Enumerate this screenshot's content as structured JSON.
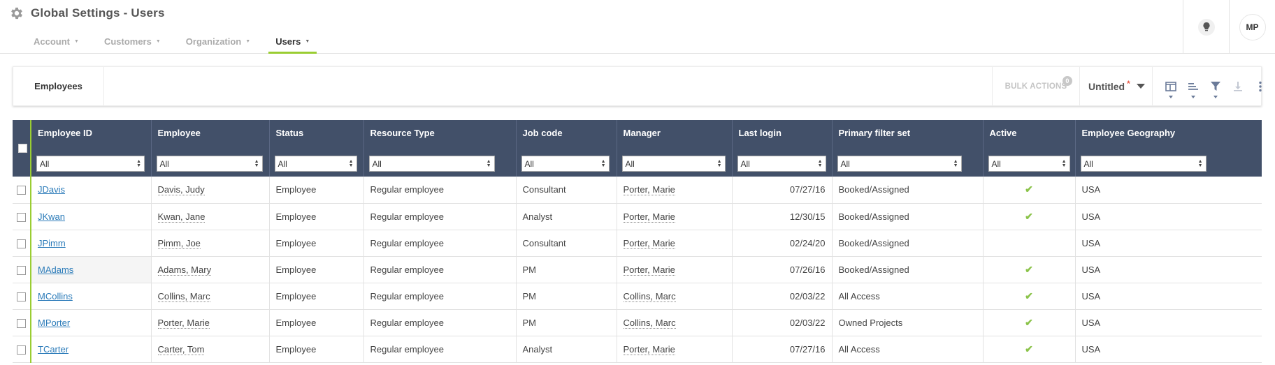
{
  "header": {
    "title": "Global Settings - Users",
    "tabs": [
      {
        "label": "Account"
      },
      {
        "label": "Customers"
      },
      {
        "label": "Organization"
      },
      {
        "label": "Users"
      }
    ],
    "avatar_initials": "MP"
  },
  "toolbar": {
    "view_title": "Employees",
    "bulk_actions_label": "BULK ACTIONS",
    "bulk_actions_count": "0",
    "saved_view_name": "Untitled",
    "unsaved_marker": "*"
  },
  "table": {
    "columns": [
      {
        "label": "Employee ID",
        "filter": "All"
      },
      {
        "label": "Employee",
        "filter": "All"
      },
      {
        "label": "Status",
        "filter": "All"
      },
      {
        "label": "Resource Type",
        "filter": "All"
      },
      {
        "label": "Job code",
        "filter": "All"
      },
      {
        "label": "Manager",
        "filter": "All"
      },
      {
        "label": "Last login",
        "filter": "All"
      },
      {
        "label": "Primary filter set",
        "filter": "All"
      },
      {
        "label": "Active",
        "filter": "All"
      },
      {
        "label": "Employee Geography",
        "filter": "All"
      }
    ],
    "rows": [
      {
        "id": "JDavis",
        "employee": "Davis, Judy",
        "status": "Employee",
        "resource_type": "Regular employee",
        "job_code": "Consultant",
        "manager": "Porter, Marie",
        "last_login": "07/27/16",
        "filter_set": "Booked/Assigned",
        "active": "✔",
        "geography": "USA"
      },
      {
        "id": "JKwan",
        "employee": "Kwan, Jane",
        "status": "Employee",
        "resource_type": "Regular employee",
        "job_code": "Analyst",
        "manager": "Porter, Marie",
        "last_login": "12/30/15",
        "filter_set": "Booked/Assigned",
        "active": "✔",
        "geography": "USA"
      },
      {
        "id": "JPimm",
        "employee": "Pimm, Joe",
        "status": "Employee",
        "resource_type": "Regular employee",
        "job_code": "Consultant",
        "manager": "Porter, Marie",
        "last_login": "02/24/20",
        "filter_set": "Booked/Assigned",
        "active": "",
        "geography": "USA"
      },
      {
        "id": "MAdams",
        "employee": "Adams, Mary",
        "status": "Employee",
        "resource_type": "Regular employee",
        "job_code": "PM",
        "manager": "Porter, Marie",
        "last_login": "07/26/16",
        "filter_set": "Booked/Assigned",
        "active": "✔",
        "geography": "USA"
      },
      {
        "id": "MCollins",
        "employee": "Collins, Marc",
        "status": "Employee",
        "resource_type": "Regular employee",
        "job_code": "PM",
        "manager": "Collins, Marc",
        "last_login": "02/03/22",
        "filter_set": "All Access",
        "active": "✔",
        "geography": "USA"
      },
      {
        "id": "MPorter",
        "employee": "Porter, Marie",
        "status": "Employee",
        "resource_type": "Regular employee",
        "job_code": "PM",
        "manager": "Collins, Marc",
        "last_login": "02/03/22",
        "filter_set": "Owned Projects",
        "active": "✔",
        "geography": "USA"
      },
      {
        "id": "TCarter",
        "employee": "Carter, Tom",
        "status": "Employee",
        "resource_type": "Regular employee",
        "job_code": "Analyst",
        "manager": "Porter, Marie",
        "last_login": "07/27/16",
        "filter_set": "All Access",
        "active": "✔",
        "geography": "USA"
      }
    ]
  },
  "colors": {
    "header_bg": "#425069",
    "accent_green": "#9acd32",
    "link_blue": "#2b7bb9",
    "check_green": "#8bc34a"
  }
}
